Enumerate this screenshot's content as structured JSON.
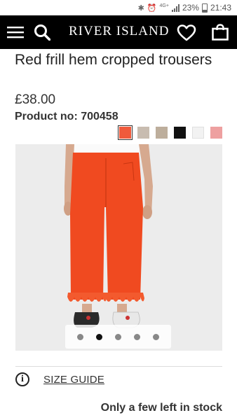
{
  "status_bar": {
    "network": "4G+",
    "battery": "23%",
    "time": "21:43"
  },
  "header": {
    "brand": "RIVER ISLAND",
    "icons": [
      "menu-icon",
      "search-icon",
      "heart-icon",
      "shopping-bag-icon"
    ]
  },
  "product": {
    "title": "Red frill hem cropped trousers",
    "price": "£38.00",
    "product_no": "Product no: 700458"
  },
  "swatches": [
    {
      "color": "#f05a3c",
      "selected": true
    },
    {
      "color": "#c8bcb0",
      "selected": false
    },
    {
      "color": "#bdae9c",
      "selected": false
    },
    {
      "color": "#111111",
      "selected": false
    },
    {
      "color": "#f2f2f2",
      "selected": false
    },
    {
      "color": "#eea0a0",
      "selected": false
    }
  ],
  "gallery": {
    "dot_count": 5,
    "active_index": 1
  },
  "size_guide": {
    "label": "SIZE GUIDE"
  },
  "stock": {
    "text": "Only a few left in stock"
  },
  "colors": {
    "header_bg": "#000000",
    "trouser": "#f04a20"
  }
}
